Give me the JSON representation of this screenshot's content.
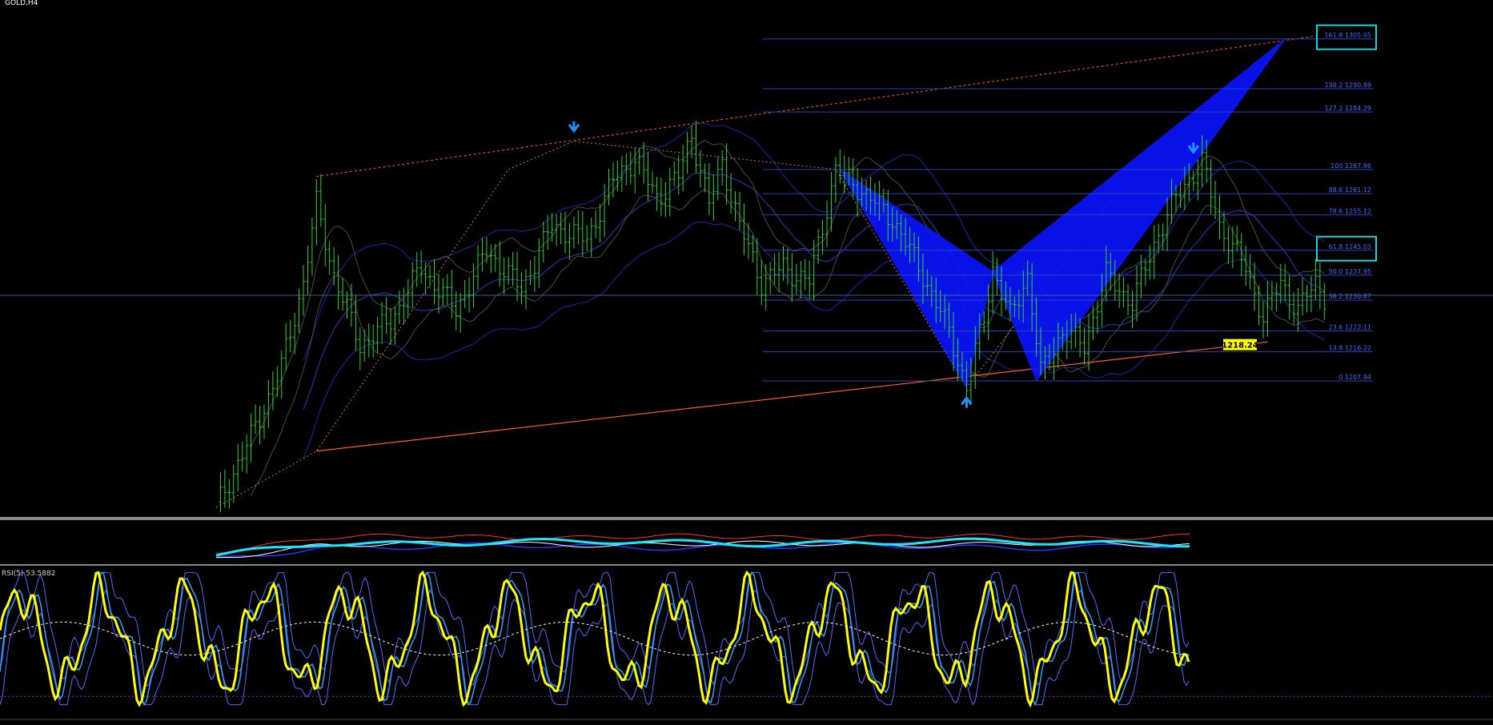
{
  "window": {
    "symbol_label": "GOLD,H4"
  },
  "indicators": {
    "rsi_label": "RSI(5) 53.5882"
  },
  "colors": {
    "background": "#000000",
    "candles": "#2fd12f",
    "harmonic_fill": "#0a14ff",
    "fib_lines": "#2b3fbf",
    "fib_text": "#3d6bff",
    "highlight_box": "#19d3e0",
    "trend_line": "#ff5a1f",
    "rsi_main": "#ffff00",
    "rsi_band": "#4f6bff",
    "rsi_signal": "#29a3ff",
    "separator": "#8a8a8a",
    "current_price_tag": "#ffff00"
  },
  "chart_data": {
    "type": "candlestick",
    "symbol": "GOLD",
    "timeframe": "H4",
    "ylim": [
      1170,
      1312
    ],
    "fibonacci_levels": [
      {
        "ratio": "161.8",
        "price": "1305.05",
        "label": "161.8 1305.05",
        "highlighted": true
      },
      {
        "ratio": "138.2",
        "price": "1290.89",
        "label": "138.2 1290.89",
        "highlighted": false
      },
      {
        "ratio": "127.2",
        "price": "1284.29",
        "label": "127.2 1284.29",
        "highlighted": false
      },
      {
        "ratio": "100",
        "price": "1267.96",
        "label": "100 1267.96",
        "highlighted": false
      },
      {
        "ratio": "88.6",
        "price": "1261.12",
        "label": "88.6 1261.12",
        "highlighted": false
      },
      {
        "ratio": "78.6",
        "price": "1255.12",
        "label": "78.6 1255.12",
        "highlighted": false
      },
      {
        "ratio": "61.8",
        "price": "1245.03",
        "label": "61.8 1245.03",
        "highlighted": true
      },
      {
        "ratio": "50.0",
        "price": "1237.95",
        "label": "50.0 1237.95",
        "highlighted": false
      },
      {
        "ratio": "38.2",
        "price": "1230.87",
        "label": "38.2 1230.87",
        "highlighted": false
      },
      {
        "ratio": "23.6",
        "price": "1222.11",
        "label": "23.6 1222.11",
        "highlighted": false
      },
      {
        "ratio": "13.8",
        "price": "1216.22",
        "label": "13.8 1216.22",
        "highlighted": false
      },
      {
        "ratio": "0",
        "price": "1207.94",
        "label": "0 1207.94",
        "highlighted": false
      }
    ],
    "current_price": "1218.24",
    "harmonic_pattern": {
      "points": [
        {
          "bar": 143,
          "price": 1268
        },
        {
          "bar": 172,
          "price": 1206
        },
        {
          "bar": 178,
          "price": 1239
        },
        {
          "bar": 188,
          "price": 1208
        },
        {
          "bar": 245,
          "price": 1305
        }
      ]
    },
    "trend_lines": {
      "upper": [
        {
          "bar": 23,
          "price": 1266
        },
        {
          "bar": 253,
          "price": 1306
        }
      ],
      "lower": [
        {
          "bar": 23,
          "price": 1188
        },
        {
          "bar": 241,
          "price": 1219
        }
      ]
    },
    "rsi": {
      "period": 5,
      "value": 53.5882,
      "ylim": [
        0,
        100
      ]
    }
  }
}
